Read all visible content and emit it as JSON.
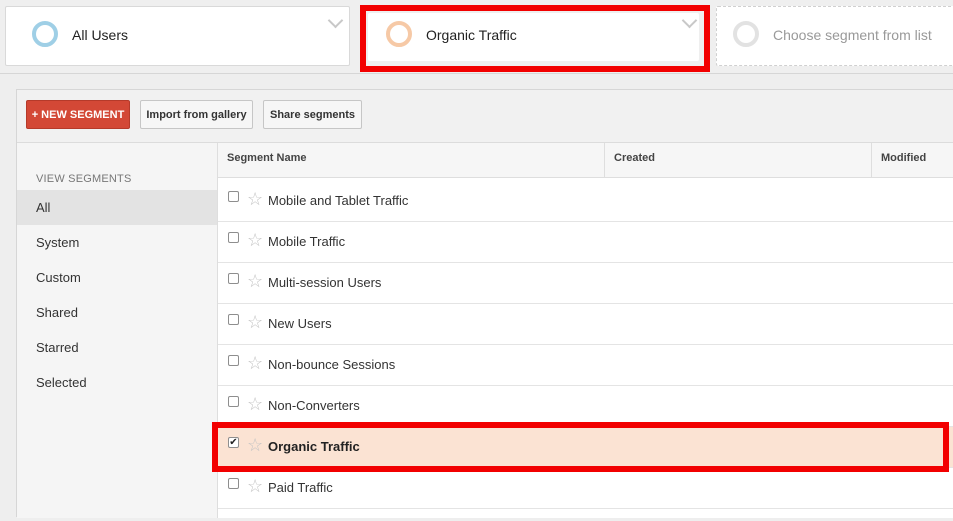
{
  "segments": [
    {
      "label": "All Users"
    },
    {
      "label": "Organic Traffic"
    },
    {
      "label": "Choose segment from list"
    }
  ],
  "toolbar": {
    "new_segment": "+ NEW SEGMENT",
    "import_gallery": "Import from gallery",
    "share_segments": "Share segments"
  },
  "sidebar": {
    "heading": "VIEW SEGMENTS",
    "items": [
      {
        "label": "All",
        "active": true
      },
      {
        "label": "System"
      },
      {
        "label": "Custom"
      },
      {
        "label": "Shared"
      },
      {
        "label": "Starred"
      },
      {
        "label": "Selected"
      }
    ]
  },
  "table": {
    "columns": [
      "Segment Name",
      "Created",
      "Modified"
    ],
    "rows": [
      {
        "name": "Mobile and Tablet Traffic",
        "checked": false
      },
      {
        "name": "Mobile Traffic",
        "checked": false
      },
      {
        "name": "Multi-session Users",
        "checked": false
      },
      {
        "name": "New Users",
        "checked": false
      },
      {
        "name": "Non-bounce Sessions",
        "checked": false
      },
      {
        "name": "Non-Converters",
        "checked": false
      },
      {
        "name": "Organic Traffic",
        "checked": true
      },
      {
        "name": "Paid Traffic",
        "checked": false
      }
    ]
  },
  "colors": {
    "highlight": "#f20000",
    "new_button": "#d34836",
    "selected_row": "#fbe3d3"
  },
  "icons": {
    "checkbox_checked": "✔",
    "star": "☆"
  }
}
